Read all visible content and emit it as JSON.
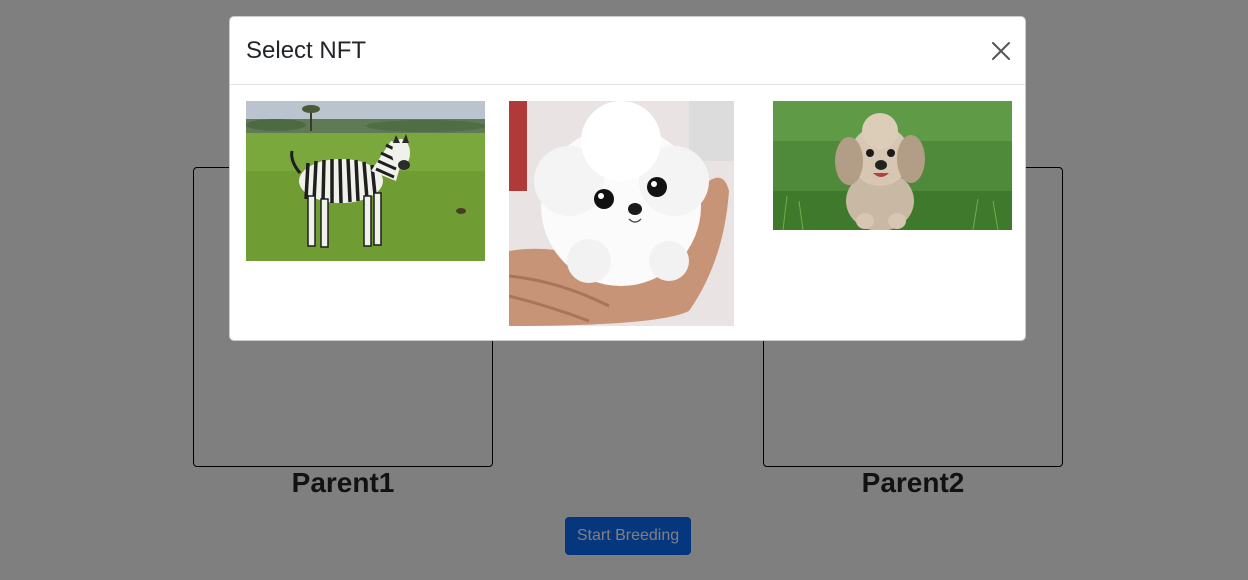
{
  "page": {
    "parent1_label": "Parent1",
    "parent2_label": "Parent2",
    "start_button_label": "Start Breeding"
  },
  "modal": {
    "title": "Select NFT",
    "close_icon": "close-icon",
    "nfts": [
      {
        "subject": "zebra"
      },
      {
        "subject": "white-puppy"
      },
      {
        "subject": "poodle-dog"
      }
    ]
  },
  "colors": {
    "primary": "#0d6efd",
    "backdrop": "rgba(0,0,0,0.5)"
  }
}
